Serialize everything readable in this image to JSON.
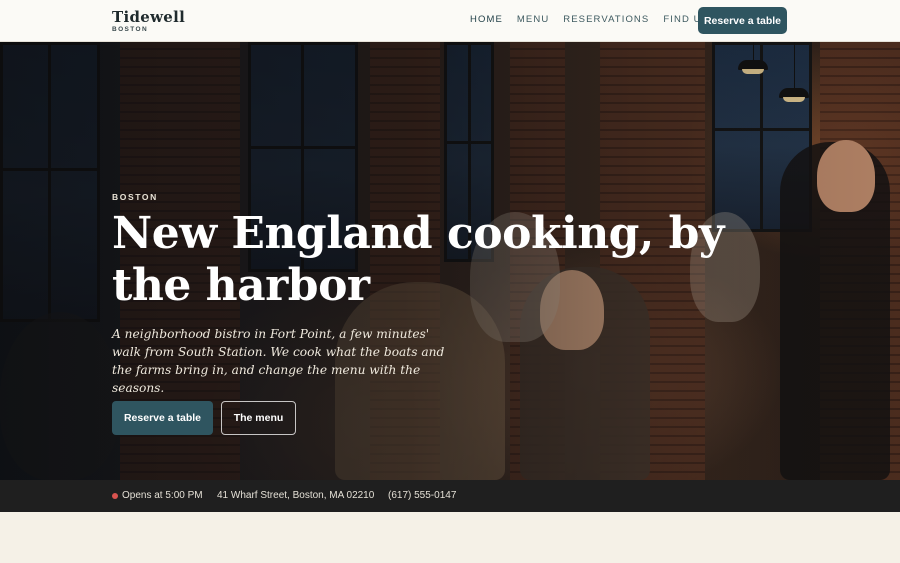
{
  "brand": {
    "name": "Tidewell",
    "city": "BOSTON"
  },
  "nav": {
    "items": [
      {
        "label": "HOME",
        "active": true
      },
      {
        "label": "MENU",
        "active": false
      },
      {
        "label": "RESERVATIONS",
        "active": false
      },
      {
        "label": "FIND US",
        "active": false
      }
    ],
    "cta_label": "Reserve a table"
  },
  "hero": {
    "eyebrow": "BOSTON",
    "headline": "New England cooking, by the harbor",
    "subcopy": "A neighborhood bistro in Fort Point, a few minutes' walk from South Station. We cook what the boats and the farms bring in, and change the menu with the seasons.",
    "primary_button": "Reserve a table",
    "secondary_button": "The menu"
  },
  "info": {
    "status": "Opens at 5:00 PM",
    "status_color": "#d9534f",
    "address": "41 Wharf Street, Boston, MA 02210",
    "phone": "(617) 555-0147"
  },
  "colors": {
    "accent": "#2f5560",
    "background": "#f5f1e7",
    "header_bg": "#fbfaf6",
    "infobar_bg": "#1f1f1f"
  }
}
